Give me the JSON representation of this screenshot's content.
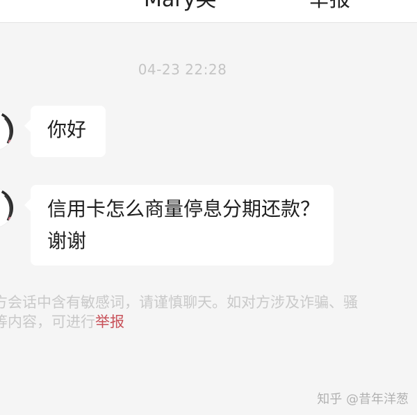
{
  "header": {
    "title": "Mary笑",
    "report_label": "举报"
  },
  "chat": {
    "timestamp": "04-23 22:28",
    "messages": [
      {
        "sender": "other",
        "text": "你好"
      },
      {
        "sender": "other",
        "text": "信用卡怎么商量停息分期还款？谢谢"
      }
    ]
  },
  "notice": {
    "line1": "方会话中含有敏感词，请谨慎聊天。如对方涉及诈骗、骚",
    "line2_prefix": "等内容，可进行",
    "report_link": "举报"
  },
  "watermark": "知乎 @昔年洋葱",
  "colors": {
    "background": "#f5f5f5",
    "bubble": "#ffffff",
    "report_link": "#c8525a",
    "muted_text": "#c9c9c9"
  }
}
